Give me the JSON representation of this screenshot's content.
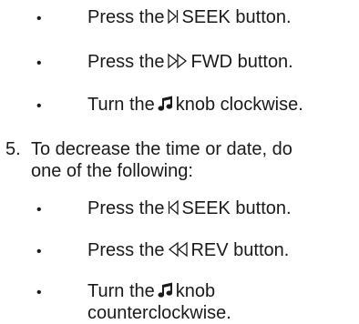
{
  "list_a": [
    {
      "pre": "Press the",
      "icon": "seek-forward-icon",
      "post": "SEEK button."
    },
    {
      "pre": "Press the",
      "icon": "fast-forward-icon",
      "post": "FWD button."
    },
    {
      "pre": "Turn the",
      "icon": "music-note-icon",
      "post": "knob clockwise."
    }
  ],
  "step": {
    "number": "5.",
    "line1": "To decrease the time or date, do",
    "line2": "one of the following:"
  },
  "list_b": [
    {
      "pre": "Press the",
      "icon": "seek-back-icon",
      "post": "SEEK button."
    },
    {
      "pre": "Press the",
      "icon": "rewind-icon",
      "post": "REV button."
    },
    {
      "pre": "Turn the",
      "icon": "music-note-icon",
      "post": "knob",
      "line2": "counterclockwise."
    }
  ],
  "bullet_char": "•"
}
